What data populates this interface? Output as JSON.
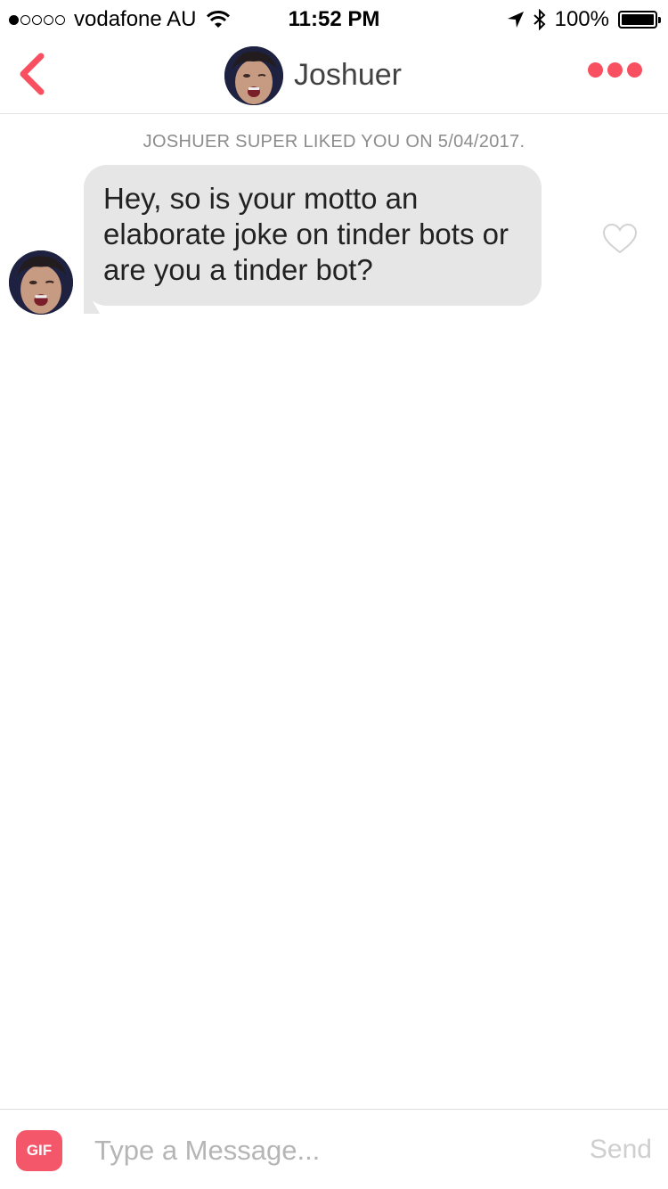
{
  "status_bar": {
    "carrier": "vodafone AU",
    "time": "11:52 PM",
    "battery": "100%",
    "signal_bars_filled": 1,
    "signal_bars_total": 5,
    "battery_level": 1.0
  },
  "header": {
    "contact_name": "Joshuer",
    "back_icon": "chevron-left-icon",
    "more_icon": "more-dots-icon",
    "accent_color": "#f85061"
  },
  "chat": {
    "super_like_notice": "JOSHUER SUPER LIKED YOU ON 5/04/2017.",
    "messages": [
      {
        "text": "Hey, so is your motto an elaborate joke on tinder bots or are you a tinder bot?",
        "liked": false
      }
    ]
  },
  "composer": {
    "gif_label": "GIF",
    "placeholder": "Type a Message...",
    "value": "",
    "send_label": "Send"
  }
}
